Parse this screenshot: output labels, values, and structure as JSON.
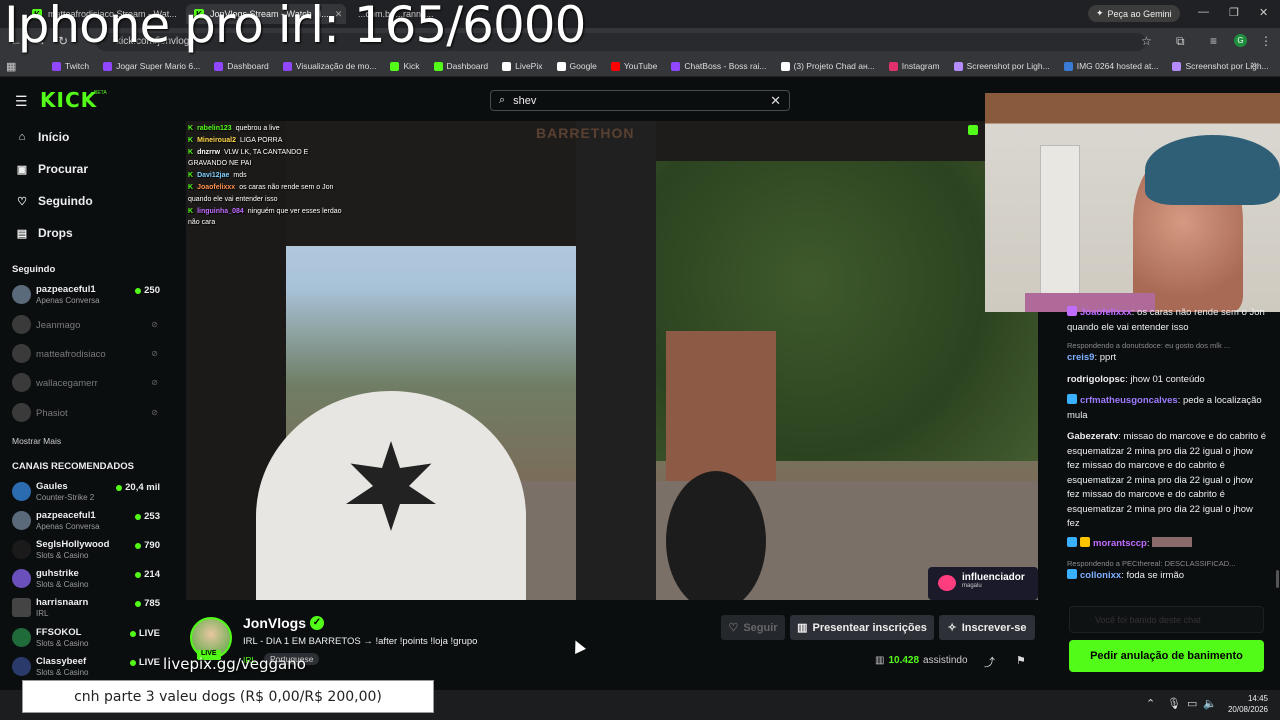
{
  "overlay": {
    "title": "Iphone pro irl: 165/6000",
    "livepix": "livepix.gg/veggano",
    "goal": "cnh parte 3 valeu dogs (R$ 0,00/R$ 200,00)"
  },
  "browser": {
    "tabs": [
      {
        "label": "matteafrodisiaco Stream - Wat..."
      },
      {
        "label": "JonVlogs Stream - Watch Li..."
      },
      {
        "label": "...com.br ...ranno..."
      }
    ],
    "gemini_label": "Peça ao Gemini",
    "address": "kick.com/jonvlogs",
    "bookmarks": [
      {
        "label": "Twitch",
        "icon": "twitch-icon",
        "color": "#9147ff"
      },
      {
        "label": "Jogar Super Mario 6...",
        "icon": "game-icon",
        "color": "#9147ff"
      },
      {
        "label": "Dashboard",
        "icon": "twitch-icon",
        "color": "#9147ff"
      },
      {
        "label": "Visualização de mo...",
        "icon": "twitch-icon",
        "color": "#9147ff"
      },
      {
        "label": "Kick",
        "icon": "kick-icon",
        "color": "#53fc18"
      },
      {
        "label": "Dashboard",
        "icon": "kick-icon",
        "color": "#53fc18"
      },
      {
        "label": "LivePix",
        "icon": "livepix-icon",
        "color": "#ffffff"
      },
      {
        "label": "Google",
        "icon": "google-icon",
        "color": "#ffffff"
      },
      {
        "label": "YouTube",
        "icon": "youtube-icon",
        "color": "#ff0000"
      },
      {
        "label": "ChatBoss - Boss rai...",
        "icon": "chatboss-icon",
        "color": "#9147ff"
      },
      {
        "label": "(3) Projeto Chad ан...",
        "icon": "x-icon",
        "color": "#ffffff"
      },
      {
        "label": "Instagram",
        "icon": "instagram-icon",
        "color": "#e1306c"
      },
      {
        "label": "Screenshot por Ligh...",
        "icon": "lightshot-icon",
        "color": "#b48cff"
      },
      {
        "label": "IMG 0264 hosted at...",
        "icon": "image-icon",
        "color": "#3a7bd5"
      },
      {
        "label": "Screenshot por Ligh...",
        "icon": "lightshot-icon",
        "color": "#b48cff"
      }
    ]
  },
  "header": {
    "logo": "KICK",
    "beta": "BETA",
    "search_value": "shev"
  },
  "nav": [
    {
      "label": "Início",
      "icon": "home-icon"
    },
    {
      "label": "Procurar",
      "icon": "browse-icon"
    },
    {
      "label": "Seguindo",
      "icon": "heart-icon"
    },
    {
      "label": "Drops",
      "icon": "drops-icon"
    }
  ],
  "following": {
    "title": "Seguindo",
    "channels": [
      {
        "name": "pazpeaceful1",
        "category": "Apenas Conversa",
        "viewers": "250",
        "live": true
      },
      {
        "name": "Jeanmago",
        "live": false
      },
      {
        "name": "matteafrodisiaco",
        "live": false
      },
      {
        "name": "wallacegamerr",
        "live": false
      },
      {
        "name": "Phasiot",
        "live": false
      }
    ],
    "show_more": "Mostrar Mais"
  },
  "recommended": {
    "title": "CANAIS RECOMENDADOS",
    "channels": [
      {
        "name": "Gaules",
        "category": "Counter-Strike 2",
        "viewers": "20,4 mil"
      },
      {
        "name": "pazpeaceful1",
        "category": "Apenas Conversa",
        "viewers": "253"
      },
      {
        "name": "SeglsHollywood",
        "category": "Slots & Casino",
        "viewers": "790"
      },
      {
        "name": "guhstrike",
        "category": "Slots & Casino",
        "viewers": "214"
      },
      {
        "name": "harrisnaarn",
        "category": "IRL",
        "viewers": "785"
      },
      {
        "name": "FFSOKOL",
        "category": "Slots & Casino",
        "viewers": "LIVE"
      },
      {
        "name": "Classybeef",
        "category": "Slots & Casino",
        "viewers": "LIVE"
      }
    ]
  },
  "video": {
    "watermark": "BARRETHON",
    "brand": "influenciador",
    "brand_sub": "magalu"
  },
  "video_chat": [
    {
      "user": "rabelin123",
      "text": "quebrou a live"
    },
    {
      "user": "Mineiroual2",
      "text": "LIGA PORRA"
    },
    {
      "user": "dnzrrw",
      "text": "VLW LK, TA CANTANDO E GRAVANDO NE PAI"
    },
    {
      "user": "Davi12jae",
      "text": "mds"
    },
    {
      "user": "Joaofelixxx",
      "text": "os caras não rende sem o Jon quando ele vai entender isso"
    },
    {
      "user": "linguinha_084",
      "text": "ninguém que ver esses lerdao não cara"
    }
  ],
  "stream": {
    "name": "JonVlogs",
    "title": "IRL - DIA 1 EM BARRETOS → !after !points !loja !grupo",
    "category": "IRL",
    "language": "Portuguese",
    "live_label": "LIVE",
    "follow_label": "Seguir",
    "gift_label": "Presentear inscrições",
    "subscribe_label": "Inscrever-se",
    "viewers": "10.428",
    "viewers_suffix": "assistindo"
  },
  "chat": {
    "messages": [
      {
        "user": "Joaofelixxx",
        "text": "os caras não rende sem o Jon quando ele vai entender isso",
        "color": "#c06cff"
      },
      {
        "reply": "Respondendo a donutsdoce: eu gosto dos mlk ..."
      },
      {
        "user": "creis9",
        "text": "pprt",
        "color": "#7fb0ff"
      },
      {
        "user": "rodrigolopsc",
        "text": "jhow 01 conteúdo",
        "color": "#ffffff"
      },
      {
        "user": "crfmatheusgoncalves",
        "text": "pede a localização mula",
        "color": "#9d7bff"
      },
      {
        "user": "Gabezeratv",
        "text": "missao do marcove e do cabrito é esquematizar 2 mina pro dia 22 igual o jhow fez missao do marcove e do cabrito é esquematizar 2 mina pro dia 22 igual o jhow fez missao do marcove e do cabrito é esquematizar 2 mina pro dia 22 igual o jhow fez",
        "color": "#ffffff"
      },
      {
        "user": "morantsccp",
        "text": "",
        "color": "#c06cff"
      },
      {
        "reply": "Respondendo a PECthereal: DESCLASSIFICAD..."
      },
      {
        "user": "collonixx",
        "text": "foda se irmão",
        "color": "#7fb0ff"
      }
    ],
    "input_placeholder": "Você foi banido deste chat",
    "unban_label": "Pedir anulação de banimento"
  },
  "taskbar": {
    "time": "14:45",
    "date": "20/08/2026"
  }
}
